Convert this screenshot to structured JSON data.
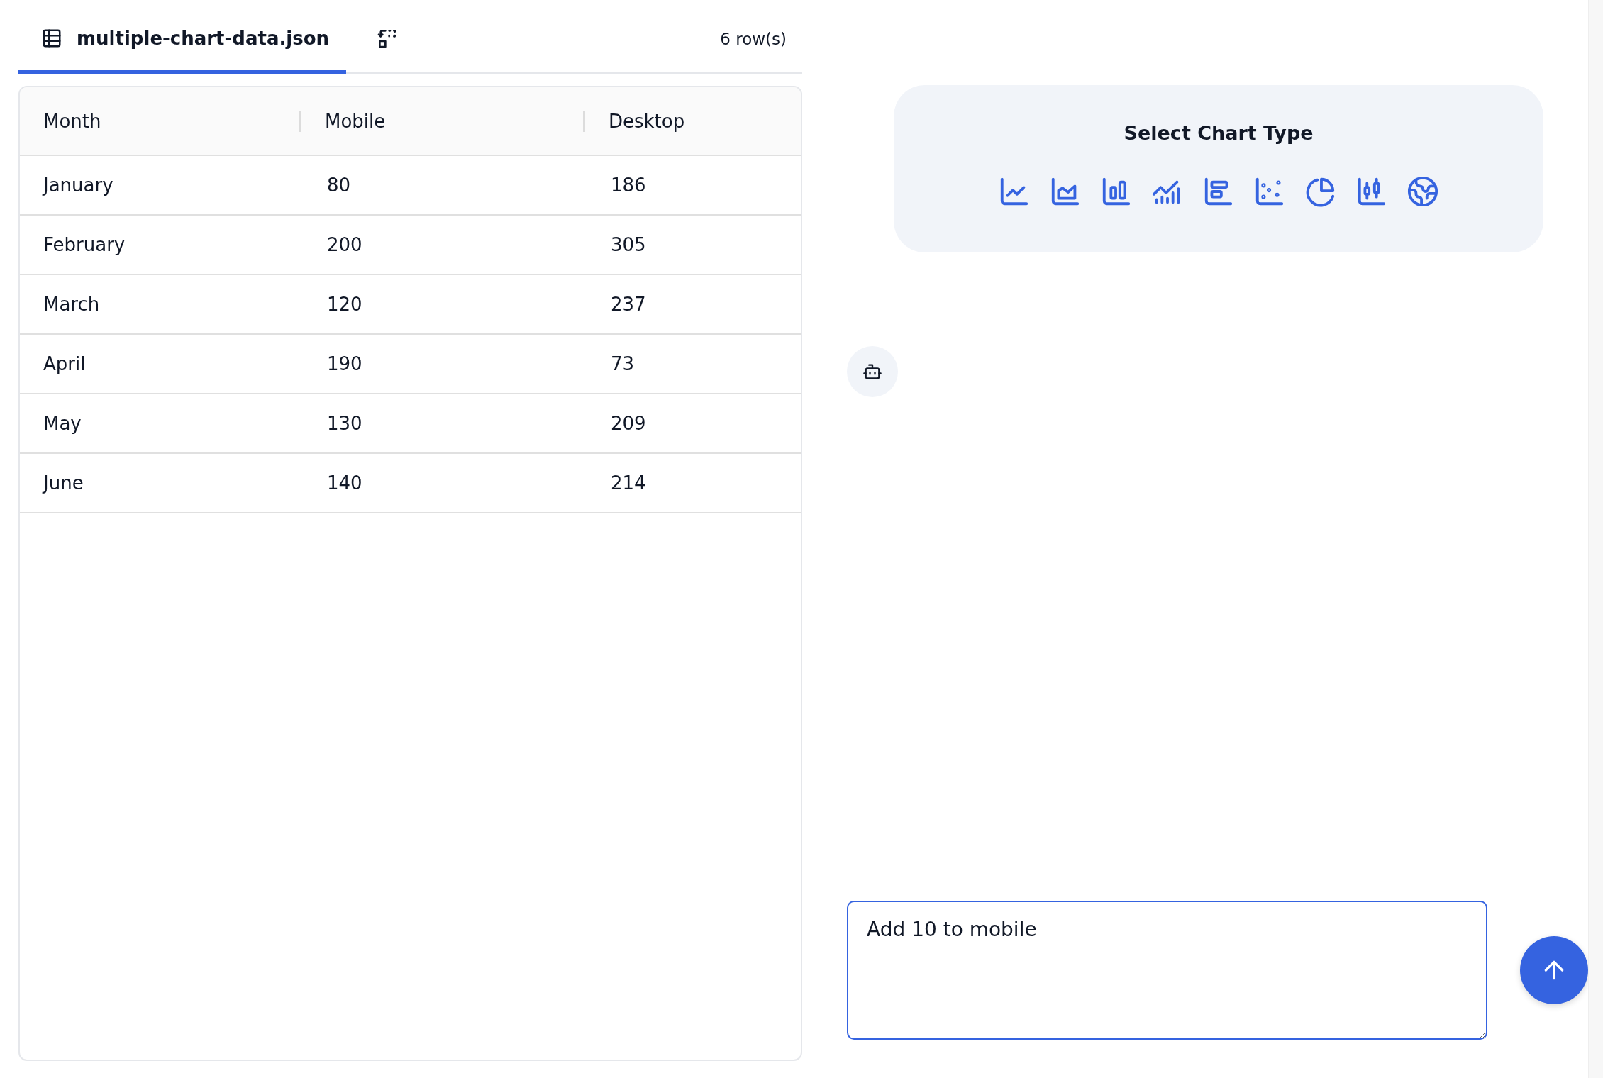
{
  "tabs": [
    {
      "kind": "file",
      "label": "multiple-chart-data.json",
      "selected": true
    },
    {
      "kind": "transform",
      "selected": false
    }
  ],
  "row_count": "6 row(s)",
  "table": {
    "columns": [
      "Month",
      "Mobile",
      "Desktop"
    ],
    "rows": [
      [
        "January",
        "80",
        "186"
      ],
      [
        "February",
        "200",
        "305"
      ],
      [
        "March",
        "120",
        "237"
      ],
      [
        "April",
        "190",
        "73"
      ],
      [
        "May",
        "130",
        "209"
      ],
      [
        "June",
        "140",
        "214"
      ]
    ]
  },
  "chart_picker": {
    "title": "Select Chart Type",
    "types": [
      {
        "kind": "line"
      },
      {
        "kind": "area"
      },
      {
        "kind": "bar"
      },
      {
        "kind": "combo"
      },
      {
        "kind": "hbar"
      },
      {
        "kind": "scatter"
      },
      {
        "kind": "pie"
      },
      {
        "kind": "candlestick"
      },
      {
        "kind": "map"
      }
    ]
  },
  "prompt": {
    "value": "Add 10 to mobile",
    "focused": true
  }
}
